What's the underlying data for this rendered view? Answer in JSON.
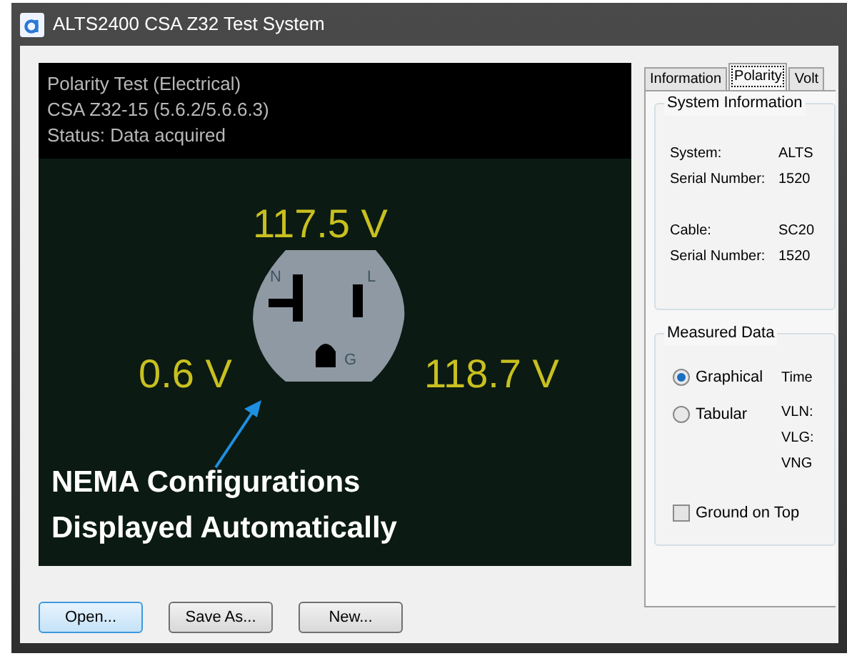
{
  "window": {
    "title": "ALTS2400 CSA Z32 Test System"
  },
  "display": {
    "header": [
      "Polarity Test (Electrical)",
      "CSA Z32-15 (5.6.2/5.6.6.3)",
      "Status: Data acquired"
    ],
    "readings": {
      "top": "117.5 V",
      "left": "0.6 V",
      "right": "118.7 V"
    },
    "outlet_labels": {
      "neutral": "N",
      "line": "L",
      "ground": "G"
    },
    "annotation": [
      "NEMA Configurations",
      "Displayed Automatically"
    ]
  },
  "tabs": [
    {
      "label": "Information",
      "selected": false
    },
    {
      "label": "Polarity",
      "selected": true
    },
    {
      "label": "Volt",
      "selected": false
    }
  ],
  "system_information": {
    "title": "System Information",
    "rows": [
      {
        "label": "System:",
        "value": "ALTS"
      },
      {
        "label": "Serial Number:",
        "value": "1520"
      },
      {
        "label": "Cable:",
        "value": "SC20"
      },
      {
        "label": "Serial Number:",
        "value": "1520"
      }
    ]
  },
  "measured_data": {
    "title": "Measured Data",
    "views": [
      {
        "label": "Graphical",
        "selected": true
      },
      {
        "label": "Tabular",
        "selected": false
      }
    ],
    "fields": [
      "Time",
      "VLN:",
      "VLG:",
      "VNG"
    ],
    "ground_on_top": {
      "label": "Ground on Top",
      "checked": false
    }
  },
  "buttons": [
    {
      "label": "Open...",
      "focused": true
    },
    {
      "label": "Save As...",
      "focused": false
    },
    {
      "label": "New...",
      "focused": false
    }
  ]
}
